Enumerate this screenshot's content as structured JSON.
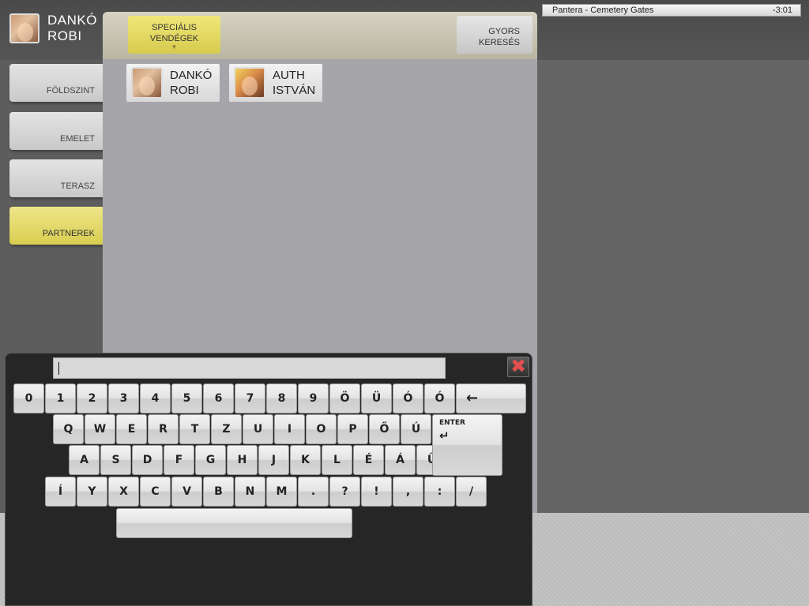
{
  "user": {
    "name": "DANKÓ\nROBI"
  },
  "now_playing": {
    "track": "Pantera - Cemetery Gates",
    "time": "-3:01"
  },
  "nav": {
    "items": [
      {
        "label": "FÖLDSZINT",
        "active": false
      },
      {
        "label": "EMELET",
        "active": false
      },
      {
        "label": "TERASZ",
        "active": false
      },
      {
        "label": "PARTNEREK",
        "active": true
      }
    ]
  },
  "header": {
    "special_guests_label": "SPECIÁLIS\nVENDÉGEK",
    "quick_search_label": "GYORS\nKERESÉS"
  },
  "partners": [
    {
      "name": "DANKÓ\nROBI"
    },
    {
      "name": "AUTH\nISTVÁN"
    }
  ],
  "keyboard": {
    "input_value": "",
    "close_symbol": "✖",
    "backspace_symbol": "←",
    "enter_label": "ENTER",
    "enter_symbol": "↵",
    "row1": [
      "0",
      "1",
      "2",
      "3",
      "4",
      "5",
      "6",
      "7",
      "8",
      "9",
      "Ö",
      "Ü",
      "Ó",
      "Ó"
    ],
    "row2": [
      "Q",
      "W",
      "E",
      "R",
      "T",
      "Z",
      "U",
      "I",
      "O",
      "P",
      "Ő",
      "Ú"
    ],
    "row3": [
      "A",
      "S",
      "D",
      "F",
      "G",
      "H",
      "J",
      "K",
      "L",
      "É",
      "Á",
      "Ű"
    ],
    "row4": [
      "Í",
      "Y",
      "X",
      "C",
      "V",
      "B",
      "N",
      "M",
      ".",
      "?",
      "!",
      ",",
      ":",
      "/"
    ]
  },
  "colors": {
    "active_yellow": "#d8cd50",
    "panel_gray": "#a6a6aa",
    "keyboard_bg": "#262626",
    "close_red": "#e45050"
  }
}
